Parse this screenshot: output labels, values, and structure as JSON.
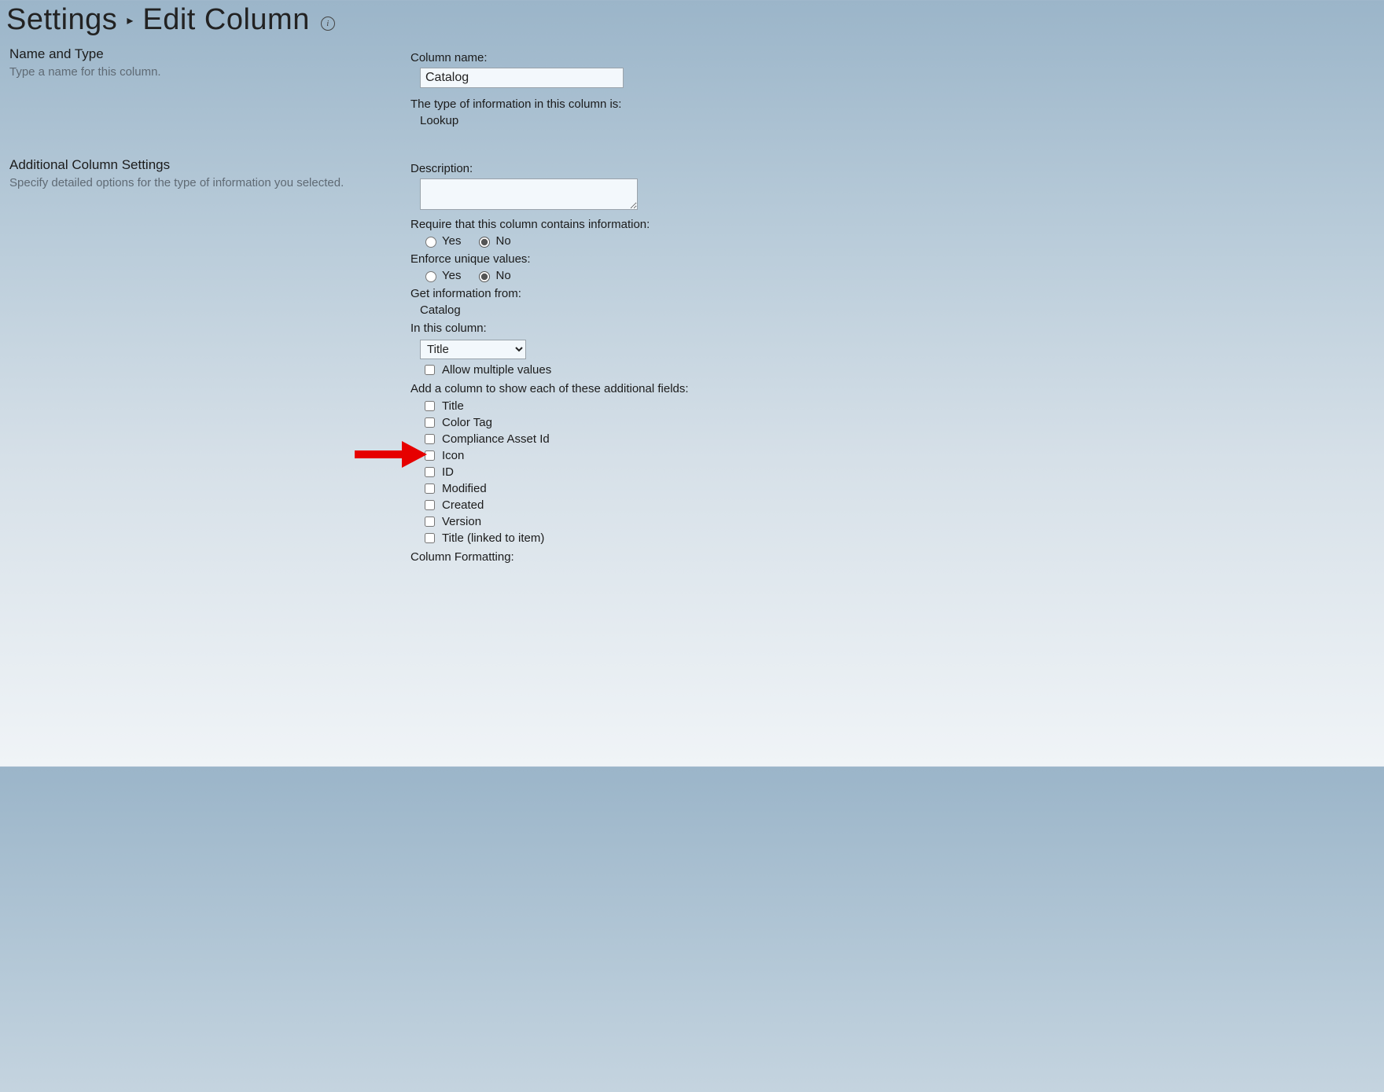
{
  "breadcrumb": {
    "settings": "Settings",
    "title": "Edit Column"
  },
  "section1": {
    "heading": "Name and Type",
    "desc": "Type a name for this column.",
    "column_name_label": "Column name:",
    "column_name_value": "Catalog",
    "type_label": "The type of information in this column is:",
    "type_value": "Lookup"
  },
  "section2": {
    "heading": "Additional Column Settings",
    "desc": "Specify detailed options for the type of information you selected.",
    "description_label": "Description:",
    "description_value": "",
    "require_label": "Require that this column contains information:",
    "yes": "Yes",
    "no": "No",
    "unique_label": "Enforce unique values:",
    "info_from_label": "Get information from:",
    "info_from_value": "Catalog",
    "in_column_label": "In this column:",
    "in_column_value": "Title",
    "allow_multi": "Allow multiple values",
    "add_fields_label": "Add a column to show each of these additional fields:",
    "fields": [
      "Title",
      "Color Tag",
      "Compliance Asset Id",
      "Icon",
      "ID",
      "Modified",
      "Created",
      "Version",
      "Title (linked to item)"
    ],
    "col_formatting_label": "Column Formatting:"
  }
}
